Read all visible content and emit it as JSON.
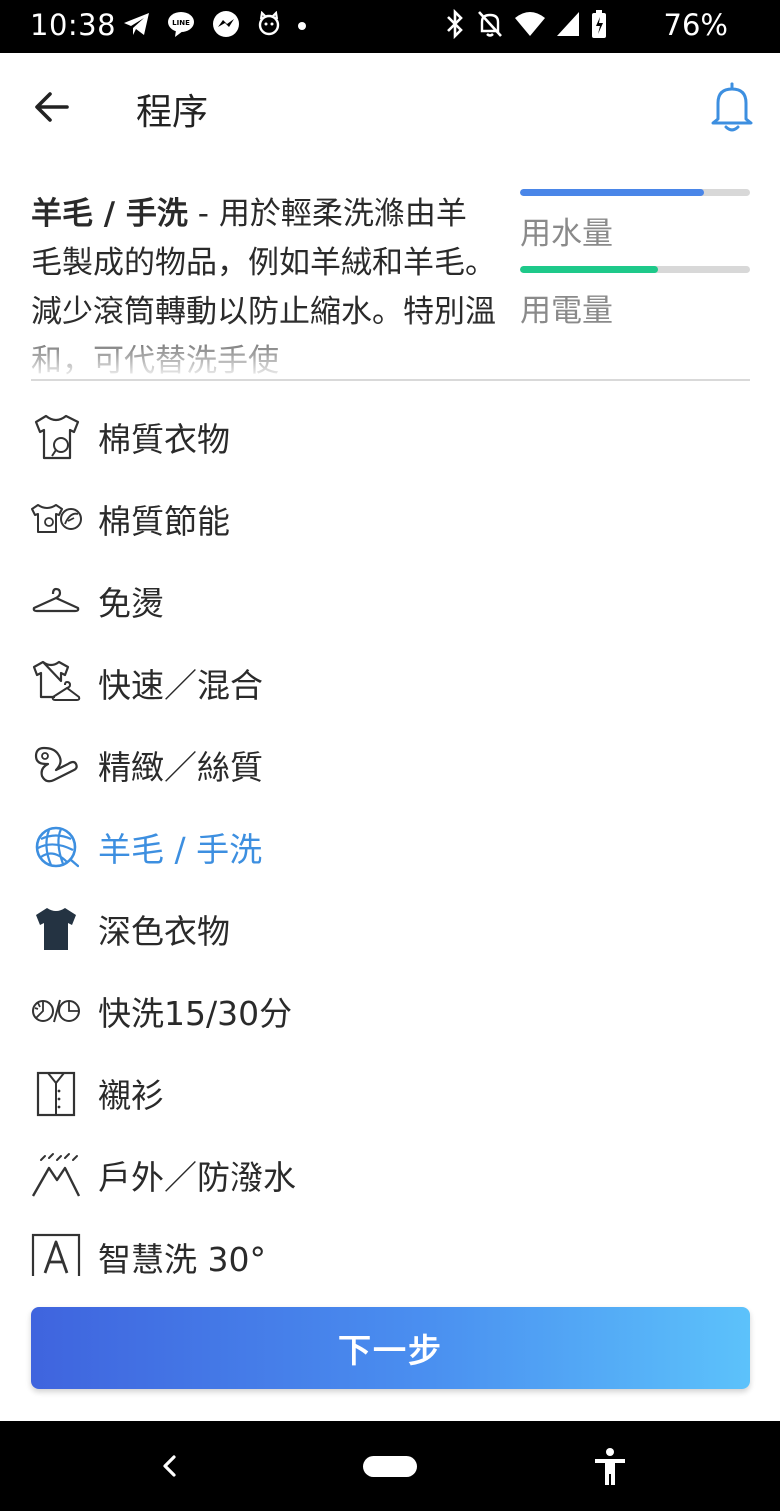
{
  "status_bar": {
    "time": "10:38",
    "left_icons": [
      "telegram-icon",
      "line-icon",
      "messenger-icon",
      "cat-icon",
      "dot-icon"
    ],
    "right_icons": [
      "bluetooth-icon",
      "mute-icon",
      "wifi-icon",
      "signal-icon",
      "battery-icon"
    ],
    "battery": "76%"
  },
  "header": {
    "title": "程序",
    "back_icon": "arrow-left-icon",
    "bell_icon": "bell-icon",
    "accent_color": "#3d8fe0"
  },
  "description": {
    "program_name": "羊毛 / 手洗",
    "text": " - 用於輕柔洗滌由羊毛製成的物品，例如羊絨和羊毛。 減少滾筒轉動以防止縮水。特別溫和，可代替洗手使"
  },
  "usage": {
    "water": {
      "label": "用水量",
      "level": 0.8,
      "color": "#4a86e8"
    },
    "power": {
      "label": "用電量",
      "level": 0.6,
      "color": "#1ec98a"
    }
  },
  "programs": [
    {
      "label": "棉質衣物",
      "icon": "cotton-shirt-icon",
      "selected": false
    },
    {
      "label": "棉質節能",
      "icon": "cotton-eco-icon",
      "selected": false
    },
    {
      "label": "免燙",
      "icon": "hanger-icon",
      "selected": false
    },
    {
      "label": "快速／混合",
      "icon": "shirt-hanger-icon",
      "selected": false
    },
    {
      "label": "精緻／絲質",
      "icon": "silk-icon",
      "selected": false
    },
    {
      "label": "羊毛 / 手洗",
      "icon": "wool-ball-icon",
      "selected": true
    },
    {
      "label": "深色衣物",
      "icon": "dark-tshirt-icon",
      "selected": false
    },
    {
      "label": "快洗15/30分",
      "icon": "quick-wash-icon",
      "selected": false
    },
    {
      "label": "襯衫",
      "icon": "dress-shirt-icon",
      "selected": false
    },
    {
      "label": "戶外／防潑水",
      "icon": "mountain-icon",
      "selected": false
    },
    {
      "label": "智慧洗 30°",
      "icon": "auto-a-icon",
      "selected": false
    }
  ],
  "next_button": {
    "label": "下一步"
  },
  "nav_bar": {
    "back_icon": "nav-back-icon",
    "home_icon": "nav-home-icon",
    "accessibility_icon": "accessibility-icon"
  }
}
